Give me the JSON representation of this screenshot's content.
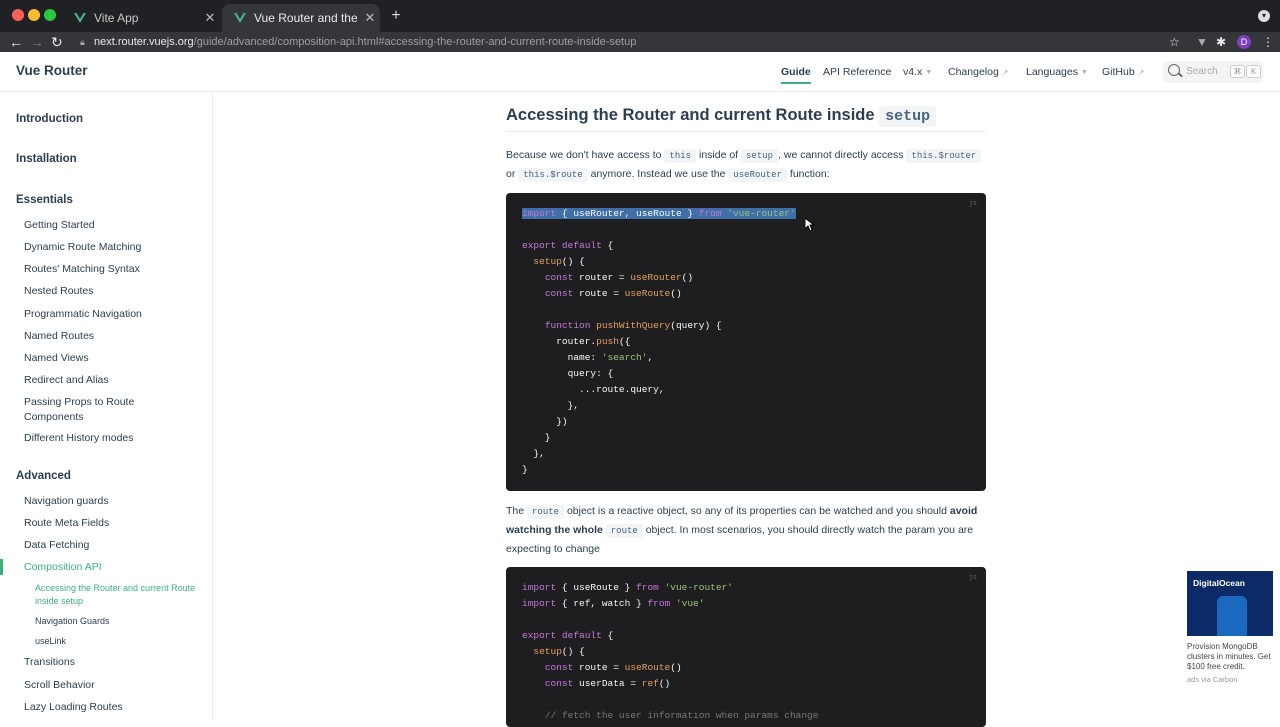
{
  "browser": {
    "tabs": [
      {
        "title": "Vite App"
      },
      {
        "title": "Vue Router and the Compositio"
      }
    ],
    "url_host": "next.router.vuejs.org",
    "url_path": "/guide/advanced/composition-api.html#accessing-the-router-and-current-route-inside-setup",
    "profile_initial": "D"
  },
  "header": {
    "logo": "Vue Router",
    "nav": {
      "guide": "Guide",
      "api": "API Reference",
      "version": "v4.x",
      "changelog": "Changelog",
      "languages": "Languages",
      "github": "GitHub"
    },
    "search": {
      "placeholder": "Search",
      "key1": "⌘",
      "key2": "K"
    }
  },
  "sidebar": {
    "groups": {
      "introduction": "Introduction",
      "installation": "Installation",
      "essentials": "Essentials",
      "advanced": "Advanced"
    },
    "essentials": [
      "Getting Started",
      "Dynamic Route Matching",
      "Routes' Matching Syntax",
      "Nested Routes",
      "Programmatic Navigation",
      "Named Routes",
      "Named Views",
      "Redirect and Alias",
      "Passing Props to Route Components",
      "Different History modes"
    ],
    "advanced": [
      "Navigation guards",
      "Route Meta Fields",
      "Data Fetching",
      "Composition API",
      "Transitions",
      "Scroll Behavior",
      "Lazy Loading Routes"
    ],
    "sub_items": [
      "Accessing the Router and current Route inside setup",
      "Navigation Guards",
      "useLink"
    ]
  },
  "content": {
    "heading_text": "Accessing the Router and current Route inside",
    "heading_code": "setup",
    "p1": {
      "t1": "Because we don't have access to",
      "c1": "this",
      "t2": "inside of",
      "c2": "setup",
      "t3": ", we cannot directly access",
      "c3": "this.$router",
      "t4": "or",
      "c4": "this.$route",
      "t5": "anymore. Instead we use the",
      "c5": "useRouter",
      "t6": "function:"
    },
    "code1_lang": "js",
    "p2": {
      "t1": "The",
      "c1": "route",
      "t2": "object is a reactive object, so any of its properties can be watched and you should",
      "b1": "avoid watching the whole",
      "c2": "route",
      "t3": "object. In most scenarios, you should directly watch the param you are expecting to change"
    },
    "code2_lang": "js"
  },
  "ad": {
    "brand": "DigitalOcean",
    "text": "Provision MongoDB clusters in minutes. Get $100 free credit.",
    "via": "ads via Carbon"
  }
}
